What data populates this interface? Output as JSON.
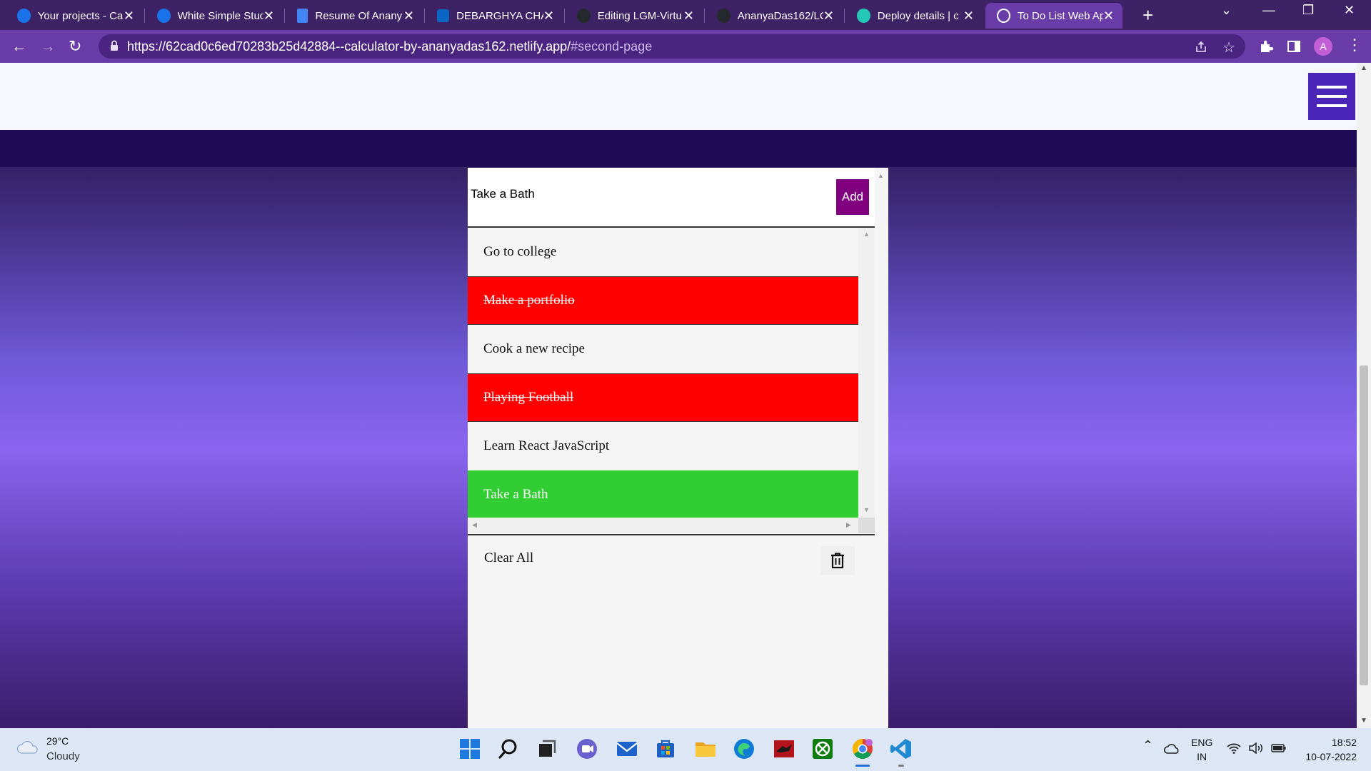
{
  "browser": {
    "tabs": [
      {
        "title": "Your projects - Ca",
        "favicon": "canva-icon",
        "favicon_color": "#1a73e8",
        "active": false
      },
      {
        "title": "White Simple Stud",
        "favicon": "canva-icon",
        "favicon_color": "#1a73e8",
        "active": false
      },
      {
        "title": "Resume Of Anany",
        "favicon": "docs-icon",
        "favicon_color": "#4285f4",
        "active": false
      },
      {
        "title": "DEBARGHYA CHA",
        "favicon": "linkedin-icon",
        "favicon_color": "#0a66c2",
        "active": false
      },
      {
        "title": "Editing LGM-Virtu",
        "favicon": "github-icon",
        "favicon_color": "#24292e",
        "active": false
      },
      {
        "title": "AnanyaDas162/LC",
        "favicon": "github-icon",
        "favicon_color": "#24292e",
        "active": false
      },
      {
        "title": "Deploy details | c",
        "favicon": "netlify-icon",
        "favicon_color": "#25c7b7",
        "active": false
      },
      {
        "title": "To Do List Web Ap",
        "favicon": "globe-icon",
        "favicon_color": "#ffffff",
        "active": true
      }
    ],
    "url_main": "https://62cad0c6ed70283b25d42884--calculator-by-ananyadas162.netlify.app/",
    "url_fragment": "#second-page",
    "profile_initial": "A",
    "accent_color": "#6a3ca8"
  },
  "todo": {
    "input_value": "Take a Bath",
    "add_label": "Add",
    "items": [
      {
        "text": "Go to college",
        "state": "normal",
        "bg": "#f5f5f5",
        "color": "#111111"
      },
      {
        "text": "Make a portfolio",
        "state": "done",
        "bg": "#ff0000",
        "color": "#ffffff"
      },
      {
        "text": "Cook a new recipe",
        "state": "normal",
        "bg": "#f5f5f5",
        "color": "#111111"
      },
      {
        "text": "Playing Football",
        "state": "done",
        "bg": "#ff0000",
        "color": "#ffffff"
      },
      {
        "text": "Learn React JavaScript",
        "state": "normal",
        "bg": "#f5f5f5",
        "color": "#111111"
      },
      {
        "text": "Take a Bath",
        "state": "new",
        "bg": "#32cd32",
        "color": "#ffffff"
      }
    ],
    "clear_label": "Clear All"
  },
  "taskbar": {
    "temperature": "29°C",
    "condition": "Cloudy",
    "lang_line1": "ENG",
    "lang_line2": "IN",
    "time": "18:52",
    "date": "10-07-2022",
    "apps": [
      "windows-start-icon",
      "search-icon",
      "task-view-icon",
      "teams-chat-icon",
      "mail-icon",
      "store-icon",
      "file-explorer-icon",
      "edge-icon",
      "game-app-icon",
      "xbox-icon",
      "chrome-icon",
      "vscode-icon"
    ]
  }
}
